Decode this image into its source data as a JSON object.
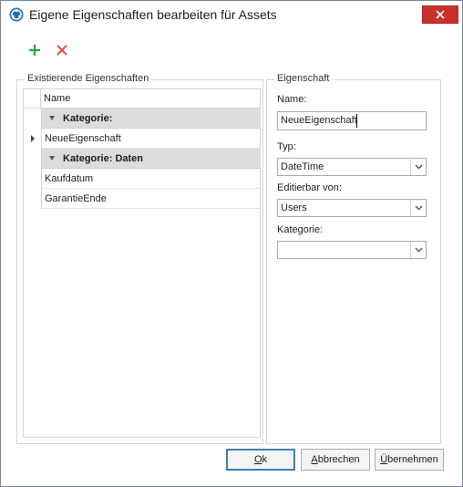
{
  "window": {
    "title": "Eigene Eigenschaften bearbeiten für Assets"
  },
  "toolbar": {
    "add_icon": "plus-icon",
    "delete_icon": "x-icon",
    "add_color": "#2da44e",
    "delete_color": "#e05a3a"
  },
  "existing": {
    "group_label": "Existierende Eigenschaften",
    "column_header": "Name",
    "rows": [
      {
        "type": "group",
        "label": "Kategorie:"
      },
      {
        "type": "item",
        "label": "NeueEigenschaft",
        "current": true
      },
      {
        "type": "group",
        "label": "Kategorie: Daten"
      },
      {
        "type": "item",
        "label": "Kaufdatum"
      },
      {
        "type": "item",
        "label": "GarantieEnde"
      }
    ]
  },
  "property": {
    "group_label": "Eigenschaft",
    "name_label": "Name:",
    "name_value": "NeueEigenschaft",
    "type_label": "Typ:",
    "type_value": "DateTime",
    "editable_label": "Editierbar von:",
    "editable_value": "Users",
    "category_label": "Kategorie:",
    "category_value": ""
  },
  "buttons": {
    "ok_mnemonic": "O",
    "ok_rest": "k",
    "cancel_mnemonic": "A",
    "cancel_rest": "bbrechen",
    "apply_mnemonic": "Ü",
    "apply_rest": "bernehmen"
  }
}
